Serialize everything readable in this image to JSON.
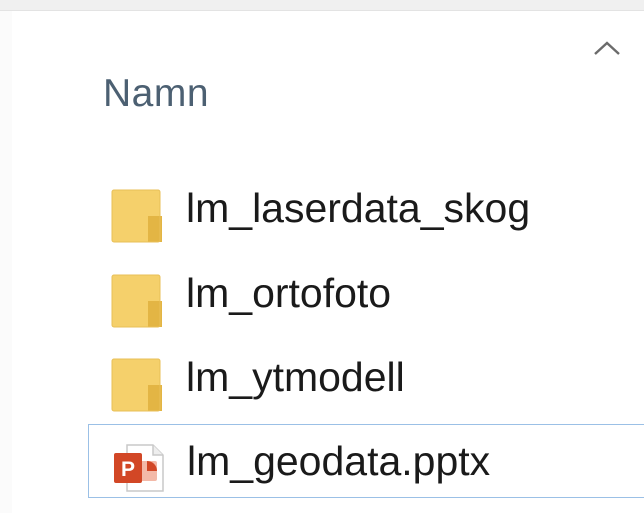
{
  "header": {
    "column_name": "Namn",
    "sort_icon": "chevron-up-icon"
  },
  "files": [
    {
      "name": "lm_laserdata_skog",
      "icon": "folder-icon",
      "type": "folder"
    },
    {
      "name": "lm_ortofoto",
      "icon": "folder-icon",
      "type": "folder"
    },
    {
      "name": "lm_ytmodell",
      "icon": "folder-icon",
      "type": "folder"
    },
    {
      "name": "lm_geodata.pptx",
      "icon": "powerpoint-file-icon",
      "type": "pptx",
      "focused": true
    }
  ],
  "colors": {
    "folder": "#f5d06b",
    "folder_dark": "#e3b544",
    "powerpoint": "#d24726",
    "focus_border": "#9bc0e6",
    "header_text": "#4c6072"
  }
}
